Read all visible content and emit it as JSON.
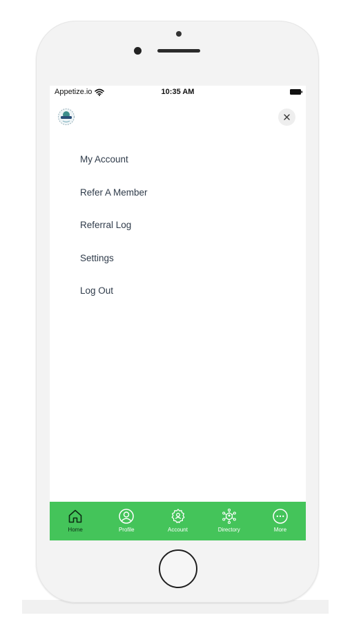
{
  "status_bar": {
    "carrier": "Appetize.io",
    "time": "10:35 AM"
  },
  "menu": {
    "items": [
      {
        "label": "My Account"
      },
      {
        "label": "Refer A Member"
      },
      {
        "label": "Referral Log"
      },
      {
        "label": "Settings"
      },
      {
        "label": "Log Out"
      }
    ]
  },
  "tab_bar": {
    "tabs": [
      {
        "label": "Home",
        "icon": "home-icon",
        "active": true
      },
      {
        "label": "Profile",
        "icon": "profile-icon"
      },
      {
        "label": "Account",
        "icon": "account-icon"
      },
      {
        "label": "Directory",
        "icon": "directory-icon"
      },
      {
        "label": "More",
        "icon": "more-icon"
      }
    ]
  },
  "colors": {
    "tab_bar": "#44c45a",
    "menu_text": "#2f3b4a",
    "active_tab_icon": "#0c2b14",
    "inactive_tab_icon": "#ffffff"
  }
}
